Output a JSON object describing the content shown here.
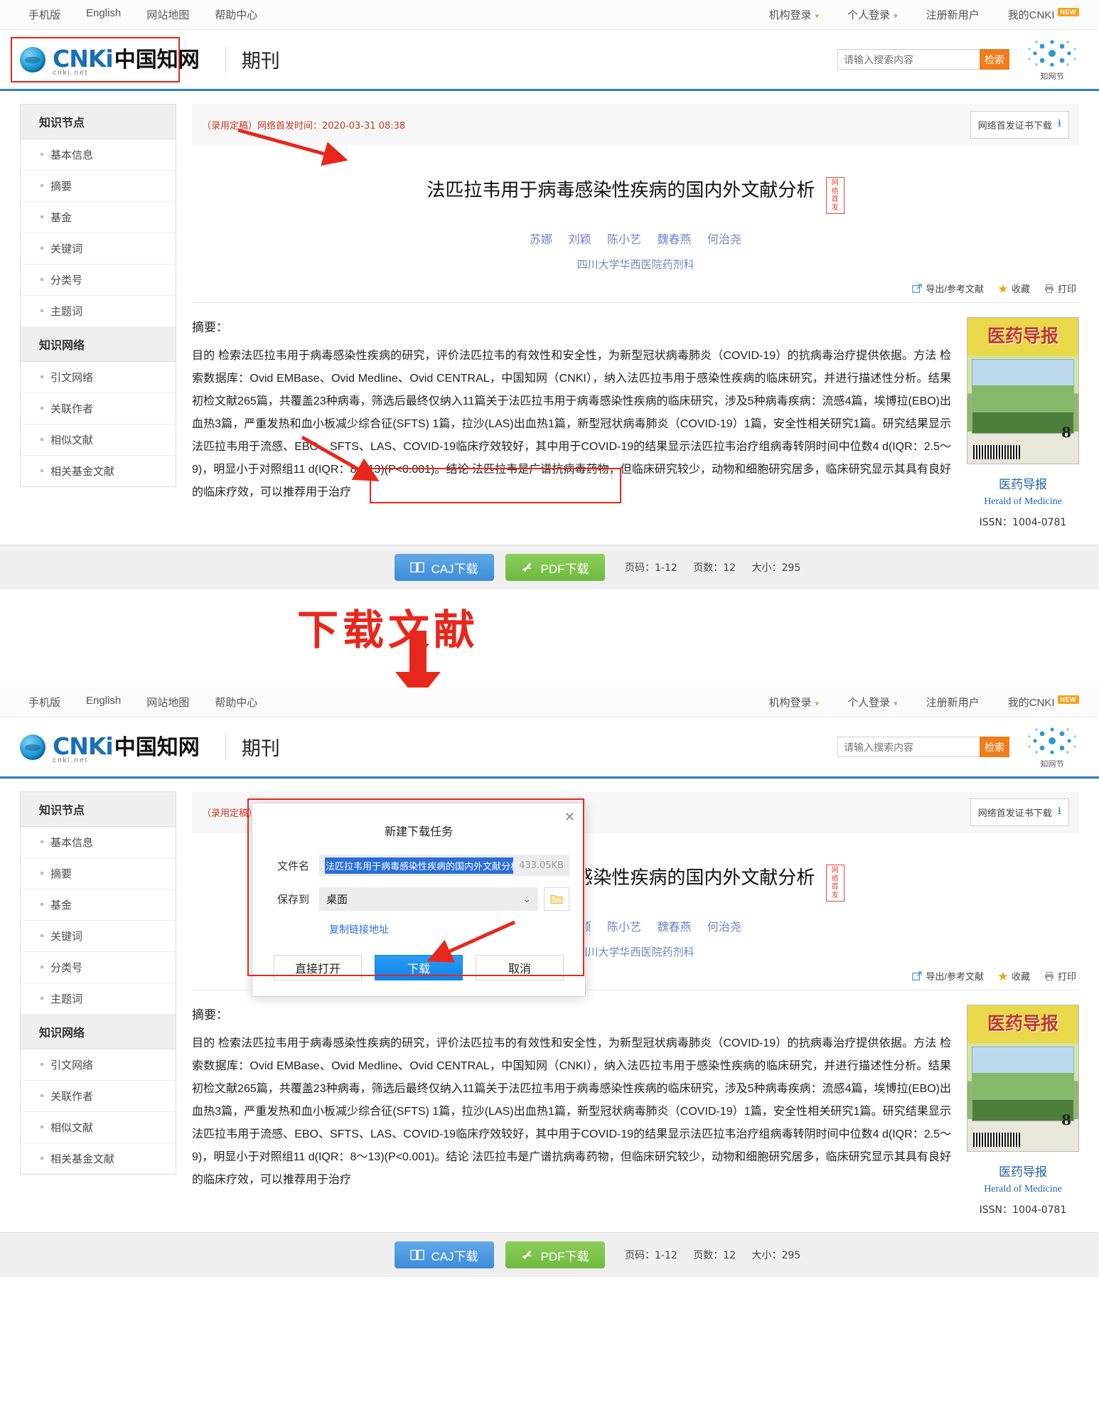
{
  "topbar": {
    "left_links": [
      "手机版",
      "English",
      "网站地图",
      "帮助中心"
    ],
    "right_links": [
      {
        "label": "机构登录",
        "caret": true
      },
      {
        "label": "个人登录",
        "caret": true
      },
      {
        "label": "注册新用户",
        "caret": false
      },
      {
        "label": "我的CNKI",
        "caret": false,
        "badge": "NEW"
      }
    ]
  },
  "header": {
    "logo_text": "CNKi",
    "logo_cn": "中国知网",
    "logo_sub": "cnki.net",
    "section_title": "期刊",
    "search_placeholder": "请输入搜索内容",
    "search_button": "检索",
    "brand_logo_text": "知网节"
  },
  "sidebar": {
    "groups": [
      {
        "title": "知识节点",
        "items": [
          "基本信息",
          "摘要",
          "基金",
          "关键词",
          "分类号",
          "主题词"
        ]
      },
      {
        "title": "知识网络",
        "items": [
          "引文网络",
          "关联作者",
          "相似文献",
          "相关基金文献"
        ]
      }
    ]
  },
  "article": {
    "pub_status": "（录用定稿）网络首发时间：2020-03-31  08:38",
    "first_pub_button": "网络首发证书下载",
    "title": "法匹拉韦用于病毒感染性疾病的国内外文献分析",
    "first_pub_badge": "网络\n首发",
    "first_pub_badge_line1": "网络",
    "first_pub_badge_line2": "首发",
    "authors": [
      "苏娜",
      "刘颖",
      "陈小艺",
      "魏春燕",
      "何治尧"
    ],
    "affiliation": "四川大学华西医院药剂科",
    "tools": [
      {
        "label": "导出/参考文献",
        "icon": "export-icon"
      },
      {
        "label": "收藏",
        "icon": "star-icon"
      },
      {
        "label": "打印",
        "icon": "printer-icon"
      }
    ],
    "abstract_label": "摘要：",
    "abstract_text": "目的 检索法匹拉韦用于病毒感染性疾病的研究，评价法匹拉韦的有效性和安全性，为新型冠状病毒肺炎（COVID-19）的抗病毒治疗提供依据。方法 检索数据库：Ovid EMBase、Ovid Medline、Ovid CENTRAL，中国知网（CNKI），纳入法匹拉韦用于感染性疾病的临床研究，并进行描述性分析。结果 初检文献265篇，共覆盖23种病毒，筛选后最终仅纳入11篇关于法匹拉韦用于病毒感染性疾病的临床研究，涉及5种病毒疾病：流感4篇，埃博拉(EBO)出血热3篇，严重发热和血小板减少综合征(SFTS) 1篇，拉沙(LAS)出血热1篇，新型冠状病毒肺炎（COVID-19）1篇，安全性相关研究1篇。研究结果显示法匹拉韦用于流感、EBO、SFTS、LAS、COVID-19临床疗效较好，其中用于COVID-19的结果显示法匹拉韦治疗组病毒转阴时间中位数4 d(IQR：2.5～9)，明显小于对照组11 d(IQR：8～13)(P<0.001)。结论 法匹拉韦是广谱抗病毒药物，但临床研究较少，动物和细胞研究居多，临床研究显示其具有良好的临床疗效，可以推荐用于治疗"
  },
  "journal": {
    "cover_title": "医药导报",
    "cover_issue": "8",
    "name": "医药导报",
    "english_name": "Herald of Medicine",
    "issn": "ISSN：1004-0781"
  },
  "download_bar": {
    "caj_label": "CAJ下载",
    "pdf_label": "PDF下载",
    "page_range_label": "页码：1-12",
    "page_count_label": "页数：12",
    "size_label": "大小：295"
  },
  "annotation": {
    "big_label": "下载文献"
  },
  "modal": {
    "title": "新建下载任务",
    "close": "✕",
    "filename_label": "文件名",
    "filename_value": "法匹拉韦用于病毒感染性疾病的国内外文献分析_苏娜",
    "filesize": "433.05KB",
    "saveto_label": "保存到",
    "saveto_value": "桌面",
    "copy_link": "复制链接地址",
    "buttons": {
      "open": "直接打开",
      "download": "下载",
      "cancel": "取消"
    }
  },
  "colors": {
    "accent_blue": "#2f7fc4",
    "orange": "#ef7d1b",
    "red": "#e8271c",
    "green": "#6fb93f",
    "link_blue": "#2a6fd8"
  }
}
